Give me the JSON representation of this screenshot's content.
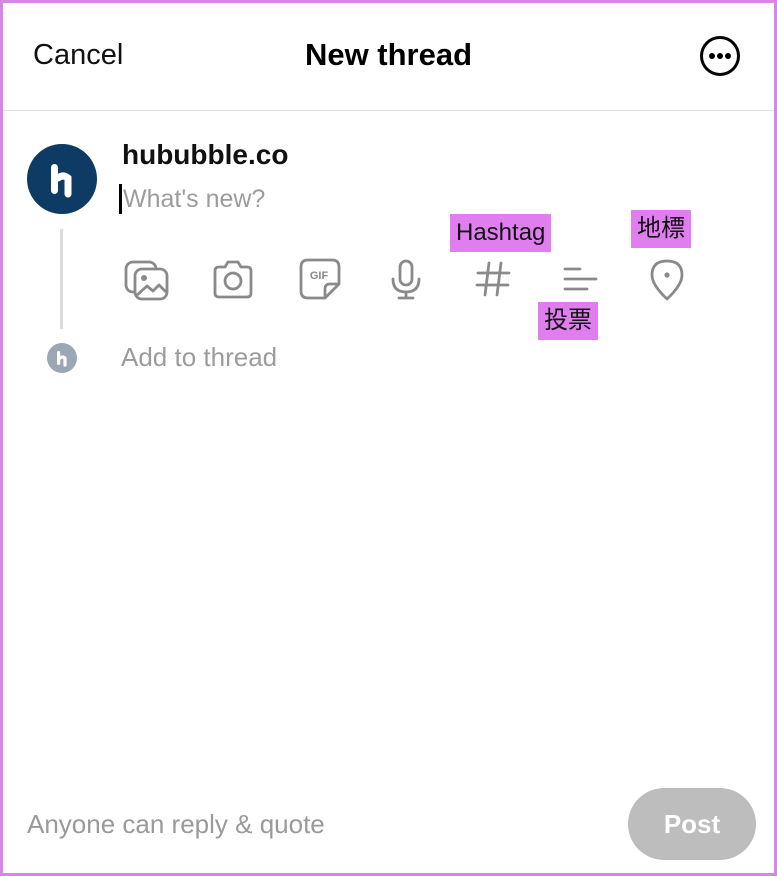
{
  "header": {
    "cancel_label": "Cancel",
    "title": "New thread",
    "more_icon": "more-horizontal-icon"
  },
  "composer": {
    "username": "hububble.co",
    "placeholder": "What's new?",
    "toolbar": [
      {
        "name": "gallery",
        "icon": "image-gallery-icon"
      },
      {
        "name": "camera",
        "icon": "camera-icon"
      },
      {
        "name": "gif",
        "icon": "gif-sticker-icon"
      },
      {
        "name": "voice",
        "icon": "microphone-icon"
      },
      {
        "name": "hashtag",
        "icon": "hashtag-icon"
      },
      {
        "name": "poll",
        "icon": "poll-icon"
      },
      {
        "name": "location",
        "icon": "location-pin-icon"
      }
    ],
    "add_to_thread_label": "Add to thread"
  },
  "annotations": {
    "hashtag": "Hashtag",
    "poll": "投票",
    "location": "地標"
  },
  "footer": {
    "reply_setting": "Anyone can reply & quote",
    "post_label": "Post"
  },
  "colors": {
    "frame_border": "#d985e8",
    "annotation_bg": "#e07ef0",
    "avatar_bg": "#0d3b63",
    "post_disabled": "#bdbdbd",
    "muted_text": "#9c9c9c"
  }
}
